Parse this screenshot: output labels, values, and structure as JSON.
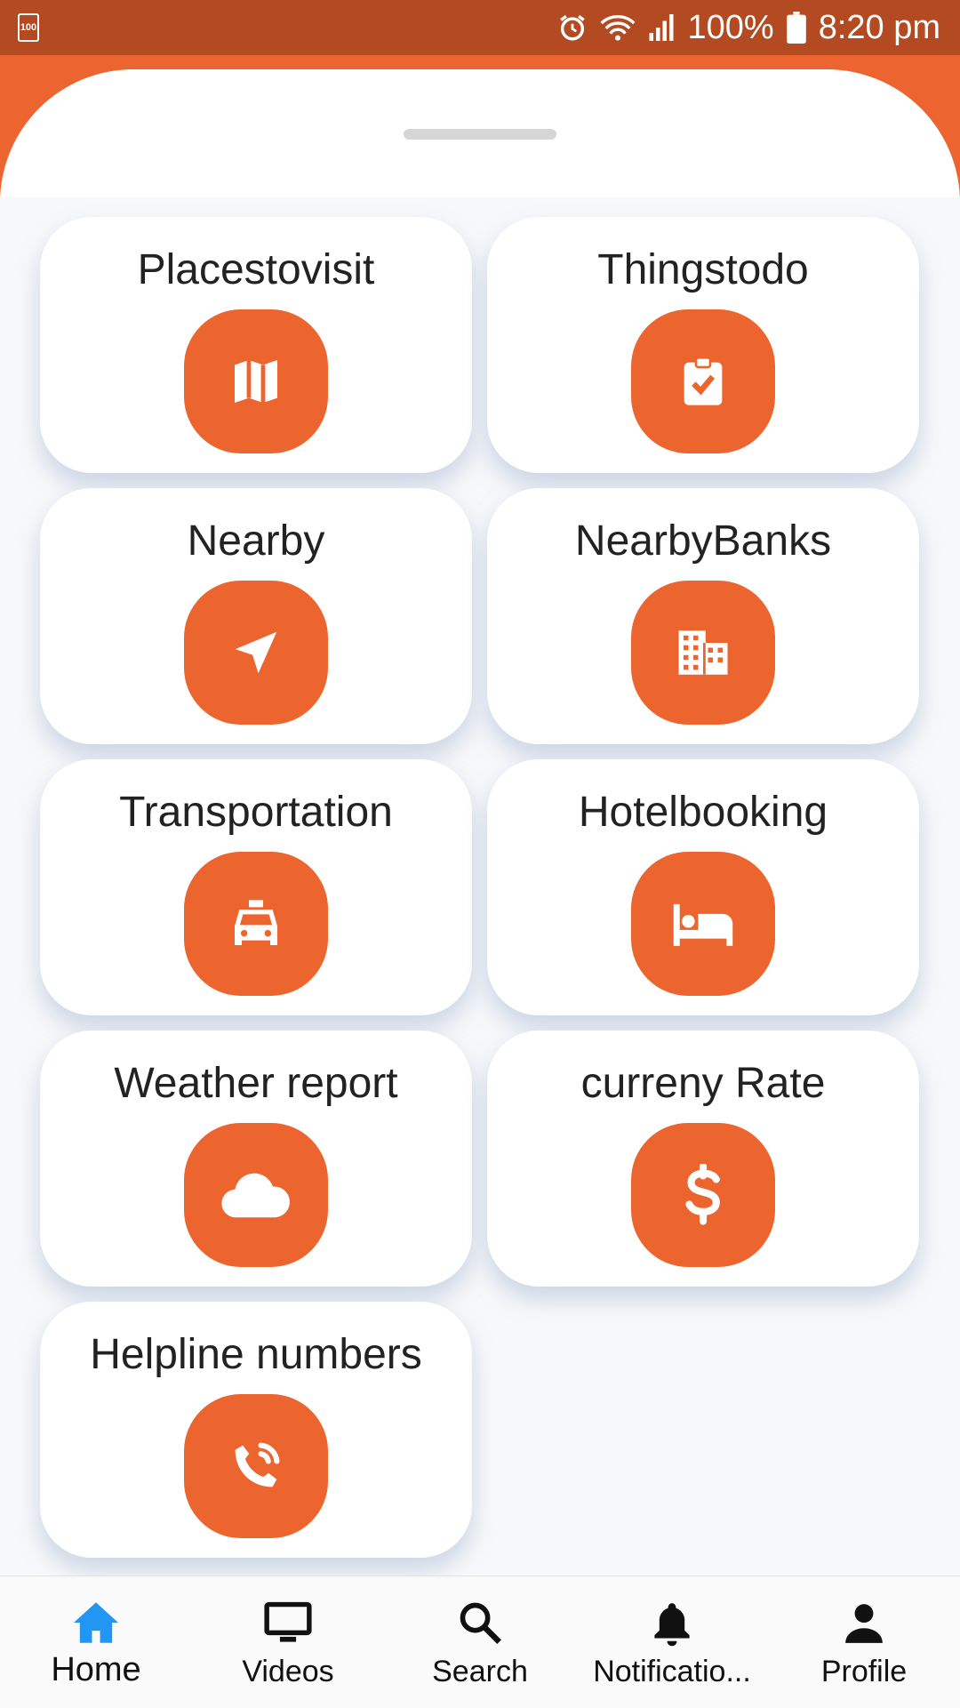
{
  "status_bar": {
    "battery_badge": "100",
    "battery_percent": "100%",
    "time": "8:20 pm",
    "icons": [
      "battery-small-icon",
      "alarm-icon",
      "wifi-icon",
      "signal-icon",
      "battery-icon"
    ]
  },
  "colors": {
    "status_bar": "#b34a21",
    "header": "#ec6530",
    "accent": "#ec642e",
    "active_nav": "#2196f3"
  },
  "cards": [
    {
      "label": "Placestovisit",
      "icon": "map-icon"
    },
    {
      "label": "Thingstodo",
      "icon": "clipboard-check-icon"
    },
    {
      "label": "Nearby",
      "icon": "navigation-arrow-icon"
    },
    {
      "label": "NearbyBanks",
      "icon": "building-icon"
    },
    {
      "label": "Transportation",
      "icon": "taxi-icon"
    },
    {
      "label": "Hotelbooking",
      "icon": "bed-icon"
    },
    {
      "label": "Weather report",
      "icon": "cloud-icon"
    },
    {
      "label": "curreny Rate",
      "icon": "dollar-icon"
    },
    {
      "label": "Helpline numbers",
      "icon": "phone-call-icon"
    }
  ],
  "bottom_nav": {
    "active": "Home",
    "items": [
      {
        "label": "Home",
        "icon": "home-icon"
      },
      {
        "label": "Videos",
        "icon": "monitor-icon"
      },
      {
        "label": "Search",
        "icon": "search-icon"
      },
      {
        "label": "Notificatio...",
        "icon": "bell-icon"
      },
      {
        "label": "Profile",
        "icon": "person-icon"
      }
    ]
  }
}
